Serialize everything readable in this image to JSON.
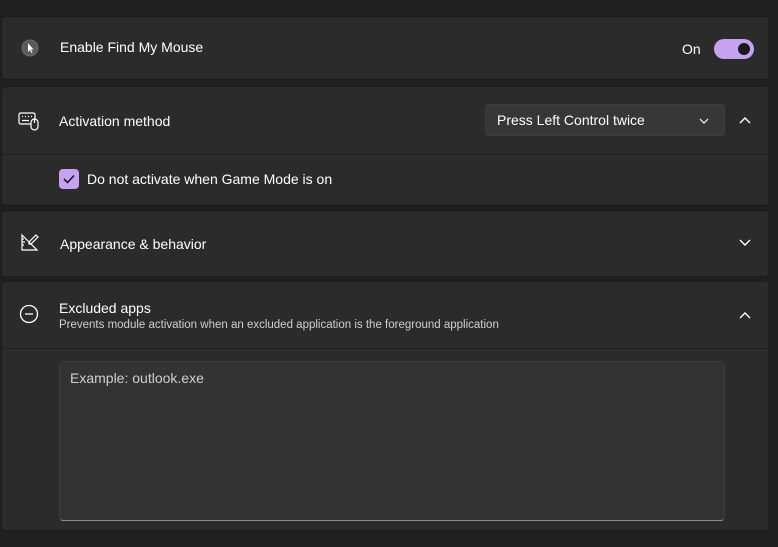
{
  "find_my_mouse": {
    "label": "Enable Find My Mouse",
    "toggle_state": "On",
    "toggle_on": true,
    "icon": "mouse-pointer-icon"
  },
  "activation": {
    "label": "Activation method",
    "selected": "Press Left Control twice",
    "icon": "keyboard-mouse-icon",
    "expanded": true
  },
  "game_mode": {
    "label": "Do not activate when Game Mode is on",
    "checked": true
  },
  "appearance": {
    "label": "Appearance & behavior",
    "icon": "design-ruler-icon",
    "expanded": false
  },
  "excluded_apps": {
    "label": "Excluded apps",
    "description": "Prevents module activation when an excluded application is the foreground application",
    "placeholder": "Example: outlook.exe",
    "icon": "minus-circle-icon",
    "expanded": true
  },
  "colors": {
    "accent": "#c8a2f2",
    "card_bg": "#2b2b2b",
    "page_bg": "#202020"
  }
}
